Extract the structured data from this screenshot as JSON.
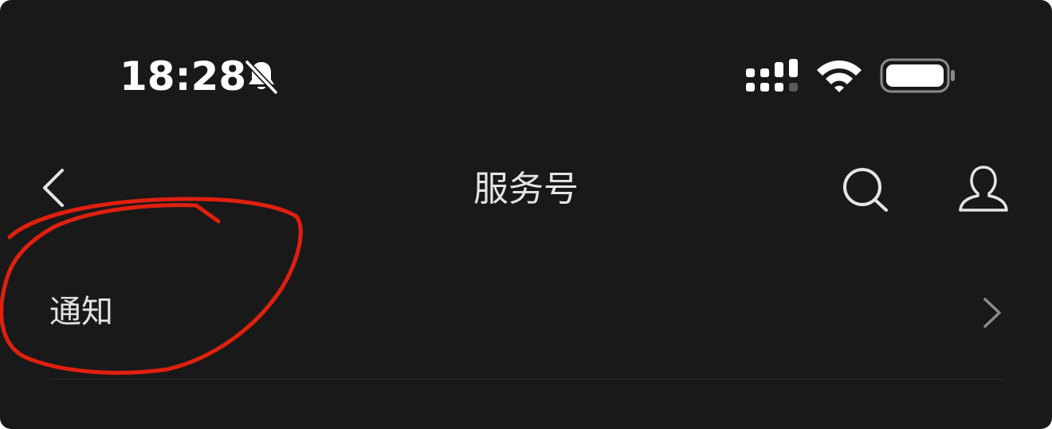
{
  "status_bar": {
    "time": "18:28",
    "icons": [
      "bell-slash-icon",
      "cellular-signal-icon",
      "wifi-icon",
      "battery-icon"
    ]
  },
  "nav_bar": {
    "back_icon": "chevron-left-icon",
    "title": "服务号",
    "right_icons": [
      "search-icon",
      "profile-icon"
    ]
  },
  "list": {
    "items": [
      {
        "label": "通知",
        "icon": "chevron-right-icon"
      }
    ]
  },
  "annotation": {
    "type": "hand-drawn-circle",
    "color": "#e0200e"
  },
  "colors": {
    "background": "#191919",
    "text": "#e5e5e5",
    "divider": "#2e2e2e"
  }
}
